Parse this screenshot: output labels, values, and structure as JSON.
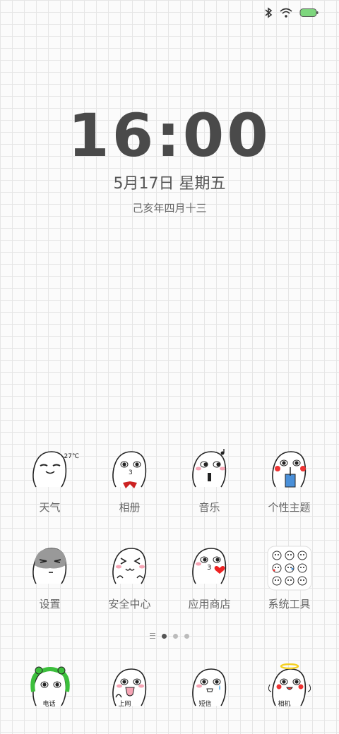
{
  "status": {
    "icons": [
      "bluetooth-icon",
      "wifi-icon",
      "battery-icon"
    ],
    "battery_color": "#7ed67e"
  },
  "clock": {
    "time": "16:00",
    "date": "5月17日 星期五",
    "lunar": "己亥年四月十三"
  },
  "row1": [
    {
      "label": "天气",
      "extra": "27℃"
    },
    {
      "label": "相册"
    },
    {
      "label": "音乐"
    },
    {
      "label": "个性主题"
    }
  ],
  "row2": [
    {
      "label": "设置"
    },
    {
      "label": "安全中心"
    },
    {
      "label": "应用商店"
    },
    {
      "label": "系统工具"
    }
  ],
  "dock": [
    {
      "label": "电话"
    },
    {
      "label": "上网"
    },
    {
      "label": "短信"
    },
    {
      "label": "相机"
    }
  ]
}
